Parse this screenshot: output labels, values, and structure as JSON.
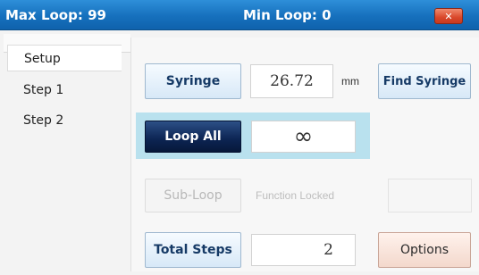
{
  "title_bar": {
    "max_loop": "Max Loop: 99",
    "min_loop": "Min Loop: 0",
    "close_glyph": "✕"
  },
  "sidebar": {
    "items": [
      {
        "label": "Setup",
        "active": true
      },
      {
        "label": "Step 1",
        "active": false
      },
      {
        "label": "Step 2",
        "active": false
      }
    ]
  },
  "setup": {
    "syringe_label": "Syringe",
    "syringe_value": "26.72",
    "syringe_unit": "mm",
    "find_syringe_label": "Find Syringe",
    "loop_all_label": "Loop All",
    "loop_value": "∞",
    "subloop_label": "Sub-Loop",
    "function_locked": "Function Locked",
    "total_steps_label": "Total Steps",
    "total_steps_value": "2",
    "options_label": "Options"
  },
  "colors": {
    "titlebar": "#1670bd",
    "loop_highlight": "#b9e1ee",
    "loop_button": "#0c2452"
  }
}
